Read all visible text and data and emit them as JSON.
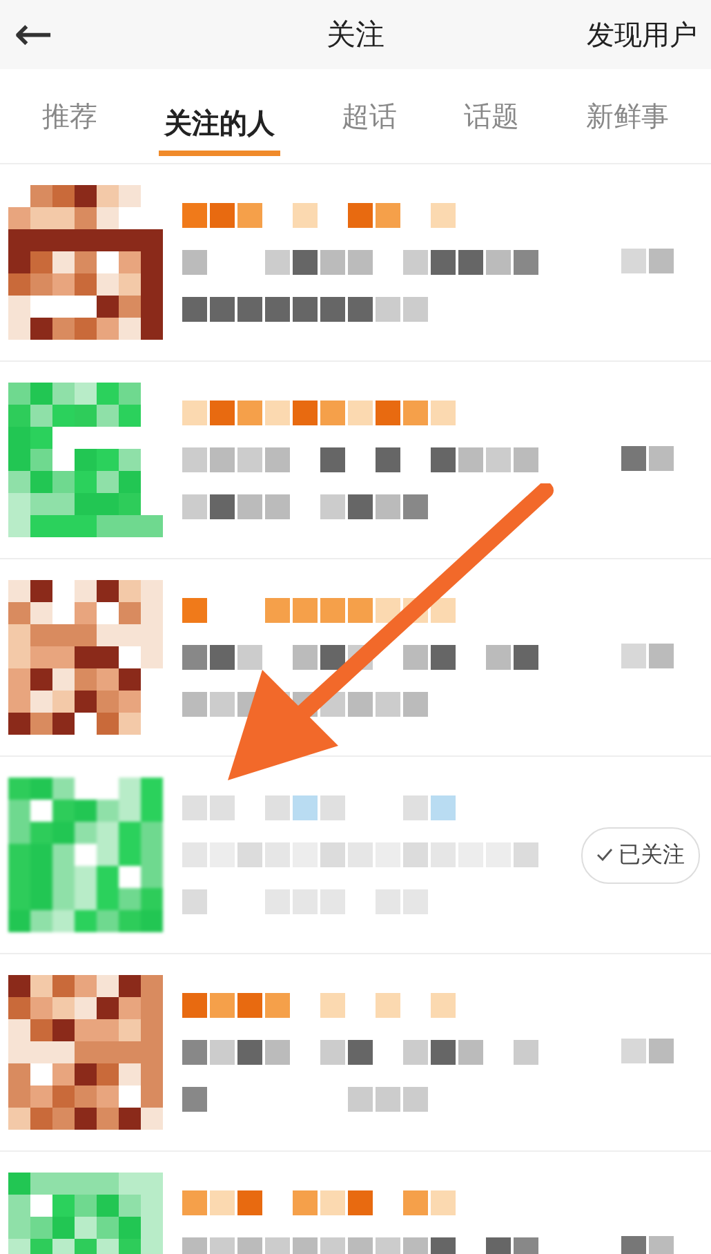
{
  "header": {
    "back": "←",
    "title": "关注",
    "action": "发现用户"
  },
  "tabs": [
    {
      "label": "推荐",
      "selected": false
    },
    {
      "label": "关注的人",
      "selected": true
    },
    {
      "label": "超话",
      "selected": false
    },
    {
      "label": "话题",
      "selected": false
    },
    {
      "label": "新鲜事",
      "selected": false
    }
  ],
  "rows": [
    {
      "kind": "mosaic"
    },
    {
      "kind": "mosaic"
    },
    {
      "kind": "mosaic"
    },
    {
      "kind": "blurred",
      "button": "已关注"
    },
    {
      "kind": "mosaic"
    },
    {
      "kind": "mosaic"
    }
  ]
}
